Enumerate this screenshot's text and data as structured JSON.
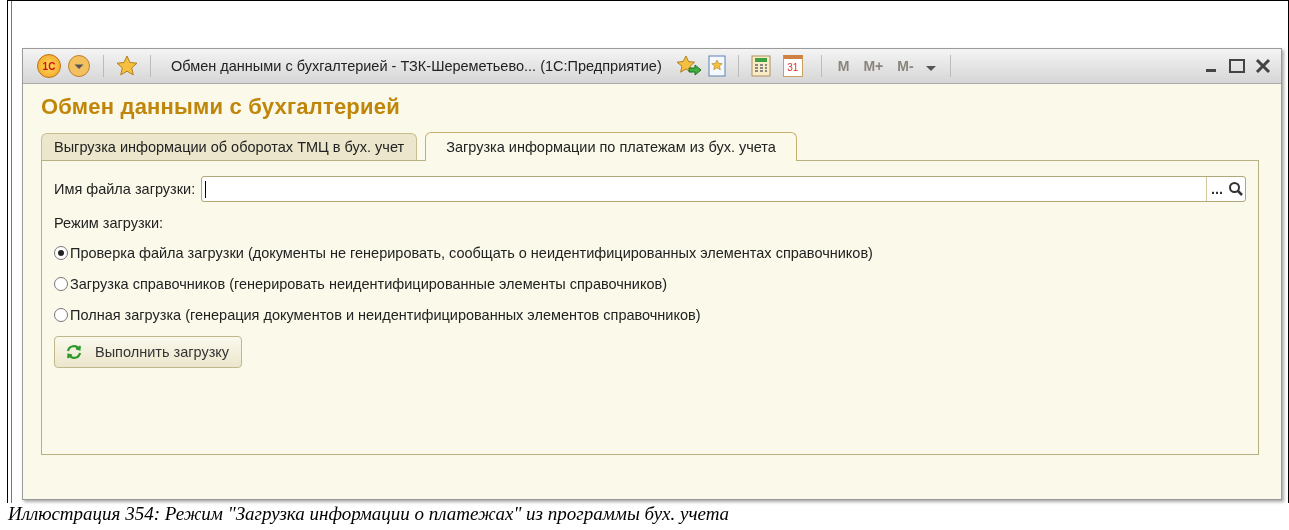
{
  "window": {
    "logo_text": "1С",
    "title": "Обмен данными с бухгалтерией - ТЗК-Шереметьево... (1С:Предприятие)",
    "calendar_day": "31",
    "memory_buttons": [
      {
        "label": "M",
        "disabled": true
      },
      {
        "label": "M+",
        "disabled": true
      },
      {
        "label": "M-",
        "disabled": true
      }
    ]
  },
  "heading": "Обмен данными с бухгалтерией",
  "tabs": [
    {
      "label": "Выгрузка информации об оборотах ТМЦ в бух. учет",
      "selected": false
    },
    {
      "label": "Загрузка информации по платежам из бух. учета",
      "selected": true
    }
  ],
  "file_field": {
    "label": "Имя файла загрузки:",
    "select_button": "..."
  },
  "mode_label": "Режим загрузки:",
  "modes": [
    {
      "label": "Проверка файла загрузки (документы не генерировать, сообщать о неидентифицированных элементах справочников)",
      "selected": true
    },
    {
      "label": "Загрузка справочников (генерировать неидентифицированные элементы справочников)",
      "selected": false
    },
    {
      "label": "Полная загрузка (генерация документов и неидентифицированных элементов справочников)",
      "selected": false
    }
  ],
  "action_button": "Выполнить загрузку",
  "caption": "Иллюстрация 354: Режим \"Загрузка информации о платежах\" из программы бух. учета"
}
